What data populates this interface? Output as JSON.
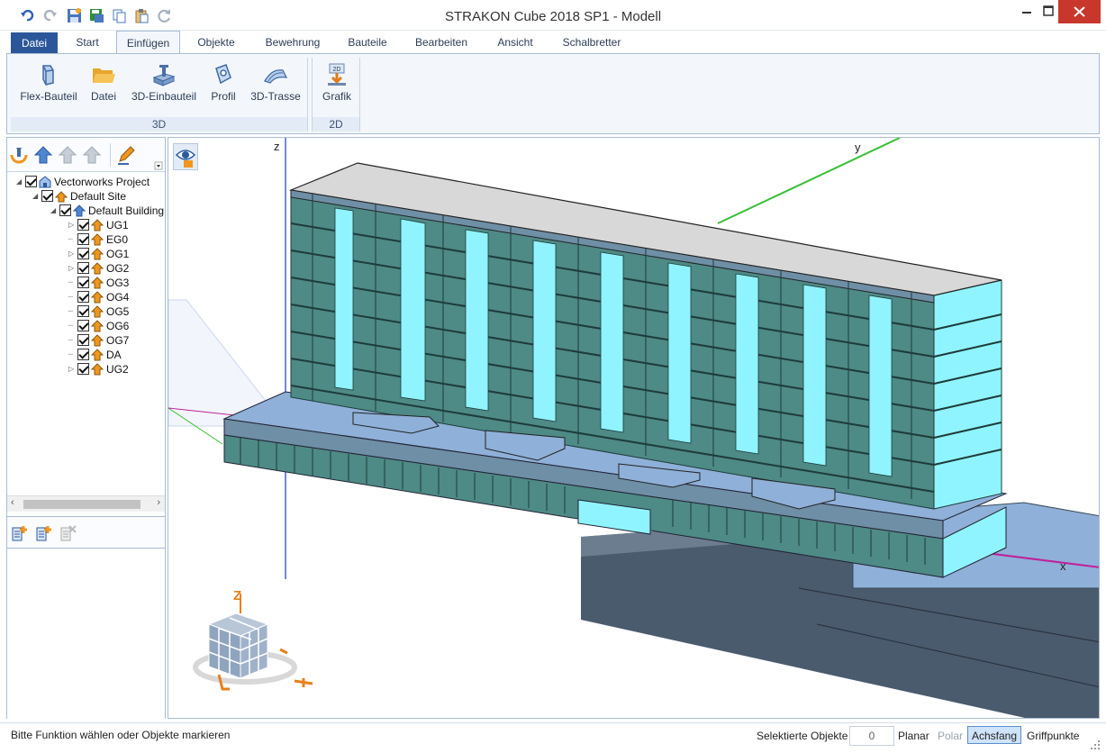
{
  "window": {
    "title": "STRAKON Cube 2018 SP1 - Modell"
  },
  "quick_access": {
    "icons": [
      "undo-icon",
      "redo-icon",
      "save-icon",
      "save-as-icon",
      "copy-icon",
      "paste-icon",
      "refresh-icon"
    ]
  },
  "tabs": [
    {
      "label": "Datei"
    },
    {
      "label": "Start"
    },
    {
      "label": "Einfügen"
    },
    {
      "label": "Objekte"
    },
    {
      "label": "Bewehrung"
    },
    {
      "label": "Bauteile"
    },
    {
      "label": "Bearbeiten"
    },
    {
      "label": "Ansicht"
    },
    {
      "label": "Schalbretter"
    }
  ],
  "ribbon": {
    "group_3d": {
      "label": "3D",
      "buttons": [
        {
          "label": "Flex-Bauteil",
          "icon": "flex-component-icon"
        },
        {
          "label": "Datei",
          "icon": "folder-icon"
        },
        {
          "label": "3D-Einbauteil",
          "icon": "3d-insert-icon"
        },
        {
          "label": "Profil",
          "icon": "profile-icon"
        },
        {
          "label": "3D-Trasse",
          "icon": "3d-route-icon"
        }
      ]
    },
    "group_2d": {
      "label": "2D",
      "buttons": [
        {
          "label": "Grafik",
          "icon": "graphic-2d-icon",
          "badge": "2D"
        }
      ]
    }
  },
  "tree": {
    "project": "Vectorworks Project",
    "site": "Default Site",
    "building": "Default Building",
    "levels": [
      {
        "label": "UG1",
        "expandable": true
      },
      {
        "label": "EG0",
        "expandable": false
      },
      {
        "label": "OG1",
        "expandable": true
      },
      {
        "label": "OG2",
        "expandable": true
      },
      {
        "label": "OG3",
        "expandable": false
      },
      {
        "label": "OG4",
        "expandable": false
      },
      {
        "label": "OG5",
        "expandable": false
      },
      {
        "label": "OG6",
        "expandable": false
      },
      {
        "label": "OG7",
        "expandable": false
      },
      {
        "label": "DA",
        "expandable": false
      },
      {
        "label": "UG2",
        "expandable": true
      }
    ]
  },
  "viewport": {
    "axis_z": "z",
    "axis_y": "y",
    "axis_x": "x",
    "cube_label": "Z",
    "colors": {
      "facade": "#4e8a86",
      "glass": "#8ff4ff",
      "slab": "#8fb0d8",
      "basement": "#4b5b6e",
      "axis_z": "#3e66c8",
      "axis_y": "#35c035",
      "axis_x": "#c0209a"
    }
  },
  "statusbar": {
    "message": "Bitte Funktion wählen oder Objekte markieren",
    "selected_label": "Selektierte Objekte",
    "selected_count": "0",
    "planar": "Planar",
    "polar": "Polar",
    "achsfang": "Achsfang",
    "griffpunkte": "Griffpunkte"
  }
}
